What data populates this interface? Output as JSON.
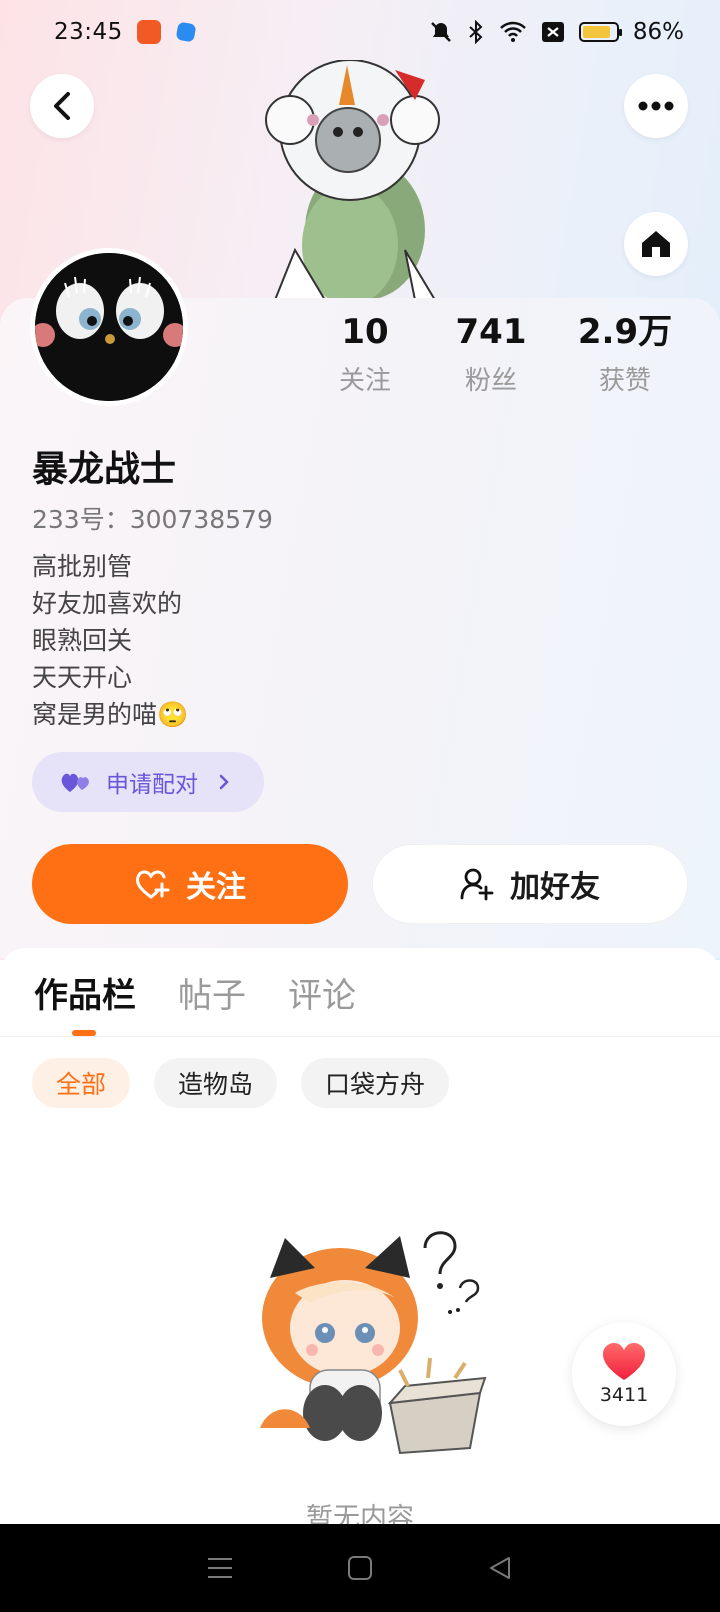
{
  "status_bar": {
    "time": "23:45",
    "battery": "86%",
    "battery_level": 0.86,
    "icons": [
      "notifications-off-icon",
      "bluetooth-icon",
      "wifi-icon",
      "sim-icon",
      "battery-icon"
    ]
  },
  "header": {
    "back_icon": "chevron-left-icon",
    "more_icon": "more-dots-icon",
    "home_icon": "home-icon"
  },
  "profile": {
    "username": "暴龙战士",
    "user_id": "233号：300738579",
    "bio": [
      "高批别管",
      "好友加喜欢的",
      "眼熟回关",
      "天天开心",
      "窝是男的喵🙄"
    ],
    "stats": [
      {
        "value": "10",
        "label": "关注"
      },
      {
        "value": "741",
        "label": "粉丝"
      },
      {
        "value": "2.9万",
        "label": "获赞"
      }
    ],
    "pair_label": "申请配对",
    "follow_label": "关注",
    "add_friend_label": "加好友"
  },
  "tabs": {
    "items": [
      "作品栏",
      "帖子",
      "评论"
    ],
    "active": 0
  },
  "filters": {
    "items": [
      "全部",
      "造物岛",
      "口袋方舟"
    ],
    "active": 0
  },
  "empty_state": {
    "text": "暂无内容"
  },
  "like_float": {
    "count": "3411"
  },
  "colors": {
    "accent": "#ff7015",
    "pair_purple": "#6a56d8",
    "heart_red": "#f5384b"
  }
}
